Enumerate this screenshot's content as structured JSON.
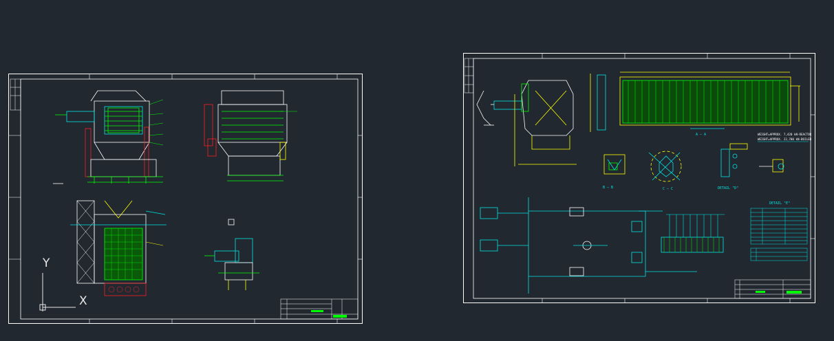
{
  "canvas": {
    "background": "#212830"
  },
  "colors": {
    "frame": "#ffffff",
    "cyan": "#00e5e5",
    "green": "#00ff00",
    "yellow": "#ffff00",
    "red": "#ff2020",
    "magenta": "#ff40ff"
  },
  "ucs_icon": {
    "y_label": "Y",
    "x_label": "X"
  },
  "right_sheet": {
    "note_line_1": "WEIGHT=APPROX. 7,420 kN-REACTOR",
    "note_line_2": "WEIGHT=APPROX. 22,700 kN-BOILER",
    "detail_e_label": "DETAIL \"E\"",
    "detail_d_label": "DETAIL \"D\"",
    "section_a_label": "A — A",
    "section_b_label": "B — B",
    "section_c_label": "C — C"
  }
}
